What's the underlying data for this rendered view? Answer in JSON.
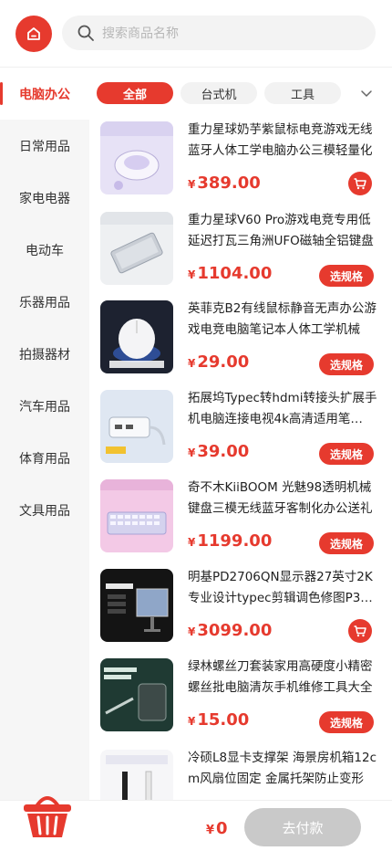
{
  "colors": {
    "accent": "#e63a2e",
    "sidebar_bg": "#f6f6f6",
    "disabled": "#c9c9c9"
  },
  "header": {
    "home_icon": "home-icon",
    "search_icon": "search-icon",
    "search_placeholder": "搜索商品名称"
  },
  "sidebar": {
    "items": [
      {
        "label": "电脑办公",
        "active": true
      },
      {
        "label": "日常用品"
      },
      {
        "label": "家电电器"
      },
      {
        "label": "电动车"
      },
      {
        "label": "乐器用品"
      },
      {
        "label": "拍摄器材"
      },
      {
        "label": "汽车用品"
      },
      {
        "label": "体育用品"
      },
      {
        "label": "文具用品"
      }
    ]
  },
  "tabs": {
    "items": [
      {
        "label": "全部",
        "active": true
      },
      {
        "label": "台式机"
      },
      {
        "label": "工具"
      }
    ],
    "expand_icon": "chevron-down-icon"
  },
  "products": [
    {
      "name": "重力星球奶芋紫鼠标电竞游戏无线蓝牙人体工学电脑办公三模轻量化",
      "price_symbol": "¥",
      "price": "389.00",
      "action": "cart"
    },
    {
      "name": "重力星球V60 Pro游戏电竞专用低延迟打瓦三角洲UFO磁轴全铝键盘",
      "price_symbol": "¥",
      "price": "1104.00",
      "action": "spec",
      "action_label": "选规格"
    },
    {
      "name": "英菲克B2有线鼠标静音无声办公游戏电竞电脑笔记本人体工学机械",
      "price_symbol": "¥",
      "price": "29.00",
      "action": "spec",
      "action_label": "选规格"
    },
    {
      "name": "拓展坞Typec转hdmi转接头扩展手机电脑连接电视4k高清适用笔…",
      "price_symbol": "¥",
      "price": "39.00",
      "action": "spec",
      "action_label": "选规格"
    },
    {
      "name": "奇不木KiiBOOM 光魅98透明机械键盘三模无线蓝牙客制化办公送礼",
      "price_symbol": "¥",
      "price": "1199.00",
      "action": "spec",
      "action_label": "选规格"
    },
    {
      "name": "明基PD2706QN显示器27英寸2K专业设计typec剪辑调色修图P3…",
      "price_symbol": "¥",
      "price": "3099.00",
      "action": "cart"
    },
    {
      "name": "绿林螺丝刀套装家用高硬度小精密螺丝批电脑清灰手机维修工具大全",
      "price_symbol": "¥",
      "price": "15.00",
      "action": "spec",
      "action_label": "选规格"
    },
    {
      "name": "冷硕L8显卡支撑架 海景房机箱12cm风扇位固定 金属托架防止变形",
      "price_symbol": "¥",
      "price": "",
      "action": "spec",
      "action_label": ""
    }
  ],
  "footer": {
    "basket_icon": "basket-icon",
    "total_symbol": "¥",
    "total": "0",
    "pay_label": "去付款"
  }
}
